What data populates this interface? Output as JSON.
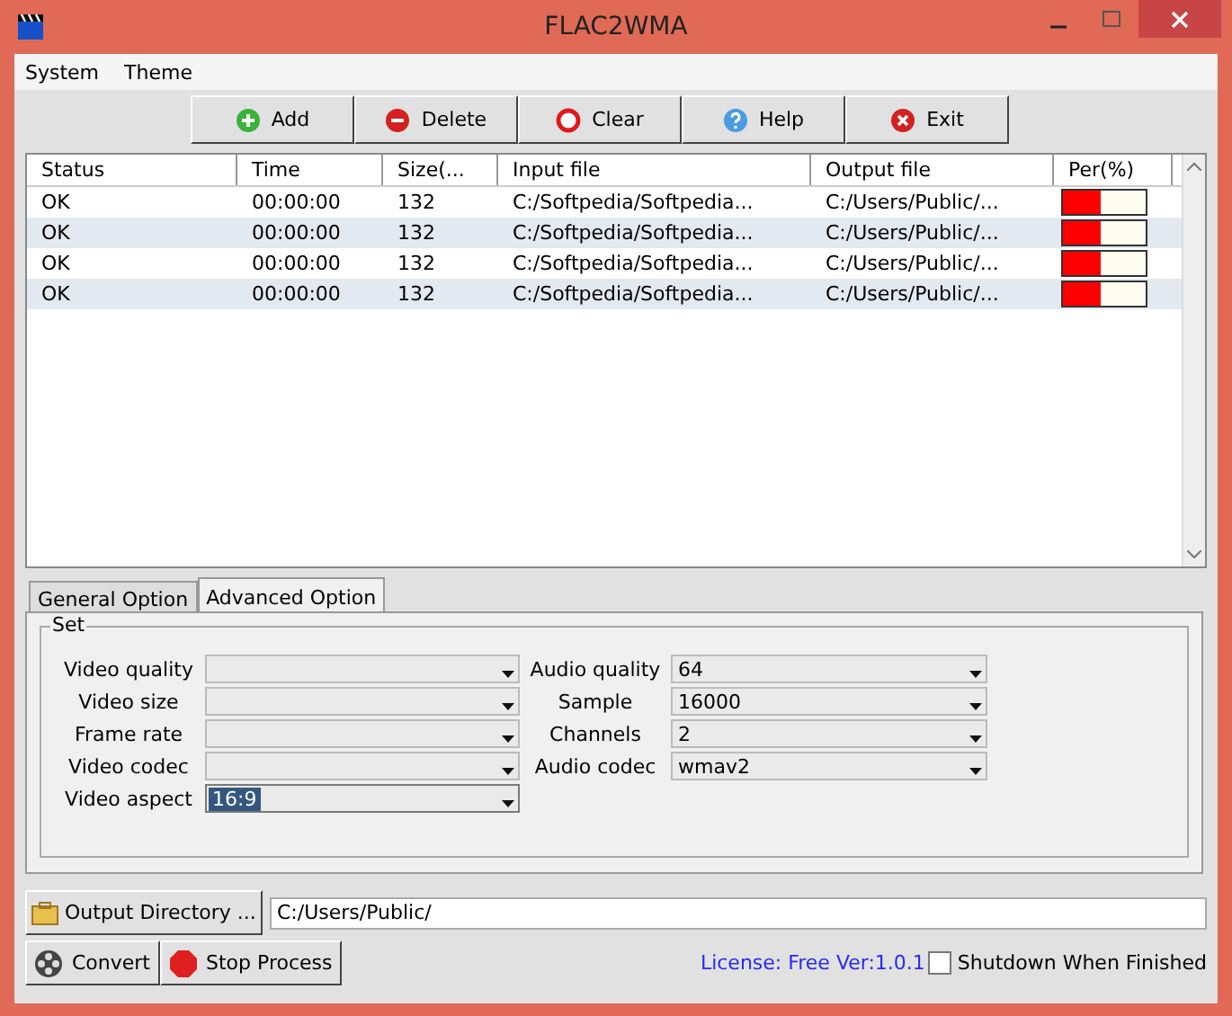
{
  "window": {
    "title": "FLAC2WMA"
  },
  "menu": [
    "System",
    "Theme"
  ],
  "toolbar": [
    {
      "label": "Add",
      "kind": "add"
    },
    {
      "label": "Delete",
      "kind": "delete"
    },
    {
      "label": "Clear",
      "kind": "clear"
    },
    {
      "label": "Help",
      "kind": "help"
    },
    {
      "label": "Exit",
      "kind": "exit"
    }
  ],
  "table": {
    "columns": [
      "Status",
      "Time",
      "Size(...",
      "Input file",
      "Output file",
      "Per(%)"
    ],
    "rows": [
      {
        "status": "OK",
        "time": "00:00:00",
        "size": "132",
        "input": "C:/Softpedia/Softpedia...",
        "output": "C:/Users/Public/...",
        "level": 0.45
      },
      {
        "status": "OK",
        "time": "00:00:00",
        "size": "132",
        "input": "C:/Softpedia/Softpedia...",
        "output": "C:/Users/Public/...",
        "level": 0.45
      },
      {
        "status": "OK",
        "time": "00:00:00",
        "size": "132",
        "input": "C:/Softpedia/Softpedia...",
        "output": "C:/Users/Public/...",
        "level": 0.45
      },
      {
        "status": "OK",
        "time": "00:00:00",
        "size": "132",
        "input": "C:/Softpedia/Softpedia...",
        "output": "C:/Users/Public/...",
        "level": 0.45
      }
    ]
  },
  "tabs": [
    {
      "label": "General Option",
      "selected": false
    },
    {
      "label": "Advanced Option",
      "selected": true
    }
  ],
  "group": {
    "title": "Set",
    "left": [
      {
        "label": "Video quality",
        "focused": false
      },
      {
        "label": "Video size",
        "focused": false
      },
      {
        "label": "Frame rate",
        "focused": false
      },
      {
        "label": "Video codec",
        "focused": false
      },
      {
        "label": "Video aspect",
        "value": "16:9",
        "focused": true
      }
    ],
    "right": [
      {
        "label": "Audio quality",
        "value": "64",
        "focused": false
      },
      {
        "label": "Sample",
        "value": "16000",
        "focused": false
      },
      {
        "label": "Channels",
        "value": "2",
        "focused": false
      },
      {
        "label": "Audio codec",
        "value": "wmav2",
        "focused": false
      }
    ]
  },
  "output_directory": {
    "button": "Output Directory ...",
    "value": "C:/Users/Public/"
  },
  "convert_button": "Convert",
  "stop_button": "Stop Process",
  "license": "License: Free Ver:1.0.1",
  "shutdown": {
    "label": "Shutdown When Finished",
    "checked": false
  }
}
